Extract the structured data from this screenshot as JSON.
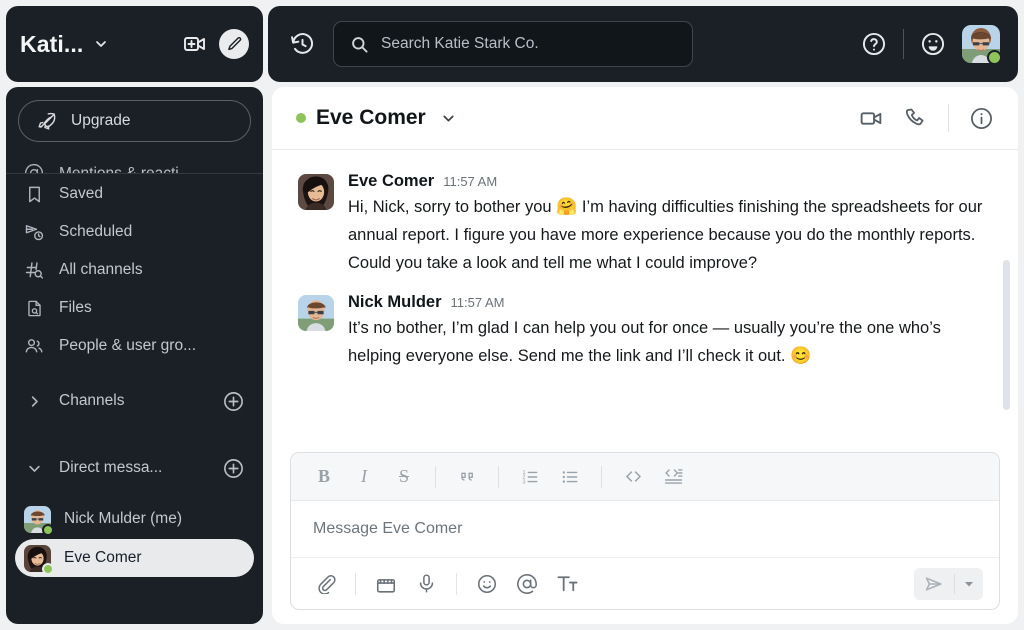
{
  "workspace": {
    "name": "Kati...",
    "caret_icon": "chevron-down-icon",
    "new_call_icon": "video-plus-icon",
    "compose_icon": "compose-icon"
  },
  "topbar": {
    "history_icon": "history-clock-icon",
    "search_icon": "search-icon",
    "search_placeholder": "Search Katie Stark Co.",
    "help_icon": "question-circle-icon",
    "emoji_status_icon": "smiley-face-icon",
    "user_avatar": "nick-mulder-avatar",
    "presence": "active"
  },
  "sidebar": {
    "upgrade": {
      "label": "Upgrade",
      "icon": "rocket-icon"
    },
    "items": [
      {
        "label": "Mentions & reacti...",
        "icon": "at-mention-icon",
        "clipped": true
      },
      {
        "label": "Saved",
        "icon": "bookmark-icon",
        "clipped": false
      },
      {
        "label": "Scheduled",
        "icon": "scheduled-send-icon",
        "clipped": false
      },
      {
        "label": "All channels",
        "icon": "hash-search-icon",
        "clipped": false
      },
      {
        "label": "Files",
        "icon": "file-search-icon",
        "clipped": false
      },
      {
        "label": "People & user gro...",
        "icon": "people-icon",
        "clipped": false
      }
    ],
    "sections": [
      {
        "label": "Channels",
        "expanded": false,
        "add_icon": "plus-circle-icon"
      },
      {
        "label": "Direct messa...",
        "expanded": true,
        "add_icon": "plus-circle-icon"
      }
    ],
    "direct_messages": [
      {
        "label": "Nick Mulder (me)",
        "avatar": "nick-mulder-avatar",
        "presence": "active",
        "active": false
      },
      {
        "label": "Eve Comer",
        "avatar": "eve-comer-avatar",
        "presence": "active",
        "active": true
      }
    ]
  },
  "conversation": {
    "title": "Eve Comer",
    "presence": "active",
    "caret_icon": "chevron-down-icon",
    "video_icon": "video-camera-icon",
    "call_icon": "phone-icon",
    "info_icon": "info-circle-icon"
  },
  "messages": [
    {
      "author": "Eve Comer",
      "time": "11:57 AM",
      "avatar": "eve-comer-avatar",
      "text_before": "Hi, Nick, sorry to bother you ",
      "emoji": "🤗",
      "text_after": " I’m having difficulties finishing the spreadsheets for our annual report. I figure you have more experience because you do the monthly reports. Could you take a look and tell me what I could improve?"
    },
    {
      "author": "Nick Mulder",
      "time": "11:57 AM",
      "avatar": "nick-mulder-avatar",
      "text_before": "It’s no bother, I’m glad I can help you out for once — usually you’re the one who’s helping everyone else. Send me the link and I’ll check it out. ",
      "emoji": "😊",
      "text_after": ""
    }
  ],
  "composer": {
    "placeholder": "Message Eve Comer",
    "format_buttons": [
      {
        "name": "bold-icon",
        "glyph": "B"
      },
      {
        "name": "italic-icon",
        "glyph": "I"
      },
      {
        "name": "strikethrough-icon",
        "glyph": "S"
      },
      {
        "name": "blockquote-icon",
        "glyph": "””"
      },
      {
        "name": "ordered-list-icon",
        "glyph": ""
      },
      {
        "name": "bulleted-list-icon",
        "glyph": ""
      },
      {
        "name": "code-icon",
        "glyph": "‹›"
      },
      {
        "name": "code-block-icon",
        "glyph": ""
      }
    ],
    "action_buttons": [
      {
        "name": "attach-file-icon"
      },
      {
        "name": "video-clip-icon"
      },
      {
        "name": "audio-clip-icon"
      },
      {
        "name": "emoji-icon"
      },
      {
        "name": "mention-icon"
      },
      {
        "name": "text-formatting-icon"
      }
    ],
    "send_icon": "send-icon",
    "send_options_icon": "chevron-down-icon"
  },
  "colors": {
    "sidebar_bg": "#1b2026",
    "page_bg": "#f0f1f3",
    "presence_green": "#8fc45a",
    "active_pill": "#e8eaec"
  }
}
